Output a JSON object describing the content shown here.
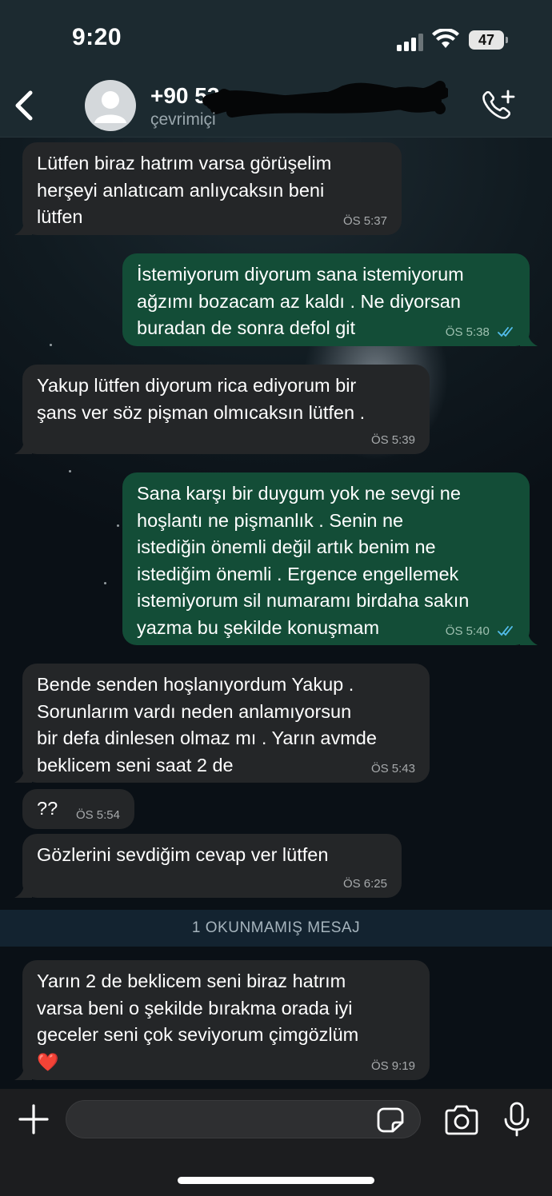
{
  "status_bar": {
    "time": "9:20",
    "battery": "47"
  },
  "header": {
    "contact_name": "+90 53",
    "contact_status": "çevrimiçi"
  },
  "messages": [
    {
      "dir": "in",
      "lines": [
        "Lütfen biraz hatrım varsa görüşelim",
        "herşeyi anlatıcam anlıycaksın beni",
        "lütfen"
      ],
      "time": "ÖS 5:37"
    },
    {
      "dir": "out",
      "lines": [
        "İstemiyorum diyorum sana istemiyorum",
        "ağzımı bozacam az kaldı . Ne diyorsan",
        "buradan de sonra defol git"
      ],
      "time": "ÖS 5:38"
    },
    {
      "dir": "in",
      "lines": [
        "Yakup lütfen diyorum rica ediyorum bir",
        "şans ver söz pişman olmıcaksın lütfen ."
      ],
      "time": "ÖS 5:39"
    },
    {
      "dir": "out",
      "lines": [
        "Sana karşı bir duygum yok ne sevgi ne",
        "hoşlantı ne pişmanlık . Senin ne",
        "istediğin önemli değil artık benim ne",
        "istediğim önemli . Ergence engellemek",
        "istemiyorum sil numaramı birdaha sakın",
        "yazma bu şekilde konuşmam"
      ],
      "time": "ÖS 5:40"
    },
    {
      "dir": "in",
      "lines": [
        "Bende senden hoşlanıyordum Yakup  .",
        "Sorunlarım vardı neden anlamıyorsun",
        "bir defa dinlesen olmaz mı . Yarın avmde",
        "beklicem seni saat 2 de"
      ],
      "time": "ÖS 5:43"
    },
    {
      "dir": "in",
      "lines": [
        "??"
      ],
      "time": "ÖS 5:54"
    },
    {
      "dir": "in",
      "lines": [
        "Gözlerini sevdiğim cevap ver lütfen"
      ],
      "time": "ÖS 6:25"
    },
    {
      "dir": "in",
      "lines": [
        "Yarın 2 de beklicem seni biraz hatrım",
        "varsa beni o şekilde bırakma orada iyi",
        "geceler seni çok seviyorum çimgözlüm"
      ],
      "emoji": "❤️",
      "time": "ÖS 9:19"
    }
  ],
  "unread_divider": "1 OKUNMAMIŞ MESAJ",
  "input": {
    "value": "",
    "placeholder": ""
  },
  "icons": {
    "back": "chevron-left-icon",
    "call": "add-call-icon",
    "plus": "plus-icon",
    "sticker": "sticker-icon",
    "camera": "camera-icon",
    "mic": "microphone-icon"
  },
  "colors": {
    "incoming_bubble": "#242628",
    "outgoing_bubble": "#134d37",
    "read_tick": "#53bdeb"
  }
}
